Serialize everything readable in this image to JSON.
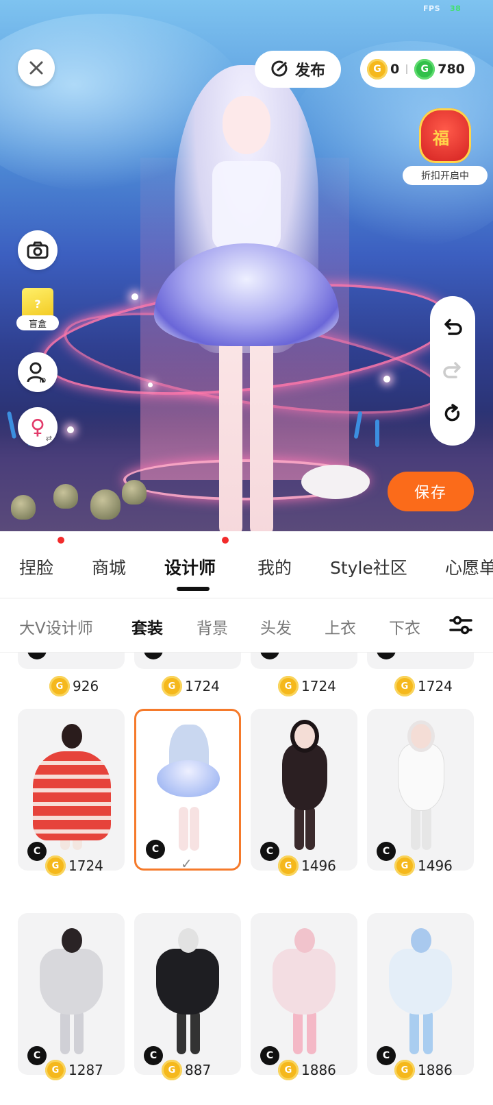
{
  "hud": {
    "fps_label": "FPS",
    "fps_value": "38",
    "publish_label": "发布",
    "currency": [
      {
        "icon": "gold-coin-icon",
        "symbol": "G",
        "value": "0",
        "color": "#f5b81c"
      },
      {
        "icon": "green-coin-icon",
        "symbol": "G",
        "value": "780",
        "color": "#31c04a"
      }
    ],
    "promo_label": "折扣开启中",
    "promo_bag_glyph": "福",
    "blindbox_label": "盲盒",
    "blindbox_glyph": "?",
    "save_label": "保存",
    "avatar_id_glyph": "ID",
    "gender_glyph": "♀",
    "gender_swap_glyph": "⇄"
  },
  "main_tabs": [
    {
      "label": "捏脸",
      "dot": true
    },
    {
      "label": "商城",
      "dot": false
    },
    {
      "label": "设计师",
      "dot": true,
      "active": true
    },
    {
      "label": "我的",
      "dot": false
    },
    {
      "label": "Style社区",
      "dot": false
    },
    {
      "label": "心愿单",
      "dot": false
    }
  ],
  "sub_tabs": [
    {
      "label": "大V设计师"
    },
    {
      "label": "套装",
      "active": true
    },
    {
      "label": "背景"
    },
    {
      "label": "头发"
    },
    {
      "label": "上衣"
    },
    {
      "label": "下衣"
    }
  ],
  "grid": {
    "badge_glyph": "C",
    "coin_symbol": "G",
    "selected_mark": "✓",
    "top_prices": [
      "926",
      "1724",
      "1724",
      "1724"
    ],
    "rows": [
      [
        {
          "price": "1724",
          "palette": "red-gown",
          "hair": "#2a1c1c",
          "dress": "#e6433b",
          "legs": "#f3e6e0"
        },
        {
          "price": "",
          "palette": "jellyfish",
          "hair": "#c9d7f0",
          "dress": "#8eaaf0",
          "legs": "#f7e2e2",
          "selected": true
        },
        {
          "price": "1496",
          "palette": "black-gothic",
          "hair": "#1c1416",
          "dress": "#2b1f22",
          "legs": "#1a1214"
        },
        {
          "price": "1496",
          "palette": "white-gothic",
          "hair": "#e8e4e4",
          "dress": "#f2f2f2",
          "legs": "#ececec"
        }
      ],
      [
        {
          "price": "1287",
          "palette": "grey-hoodie",
          "hair": "#2a2325",
          "dress": "#d8d8dc",
          "legs": "#d0d0d6"
        },
        {
          "price": "887",
          "palette": "black-hoodie",
          "hair": "#e2e2e2",
          "dress": "#1e1e22",
          "legs": "#333"
        },
        {
          "price": "1886",
          "palette": "pink-hoodie",
          "hair": "#f1c3cc",
          "dress": "#f3dde2",
          "legs": "#f4b8c6"
        },
        {
          "price": "1886",
          "palette": "blue-hoodie",
          "hair": "#a9c9ee",
          "dress": "#e4eef8",
          "legs": "#a9cdf0"
        }
      ]
    ]
  }
}
